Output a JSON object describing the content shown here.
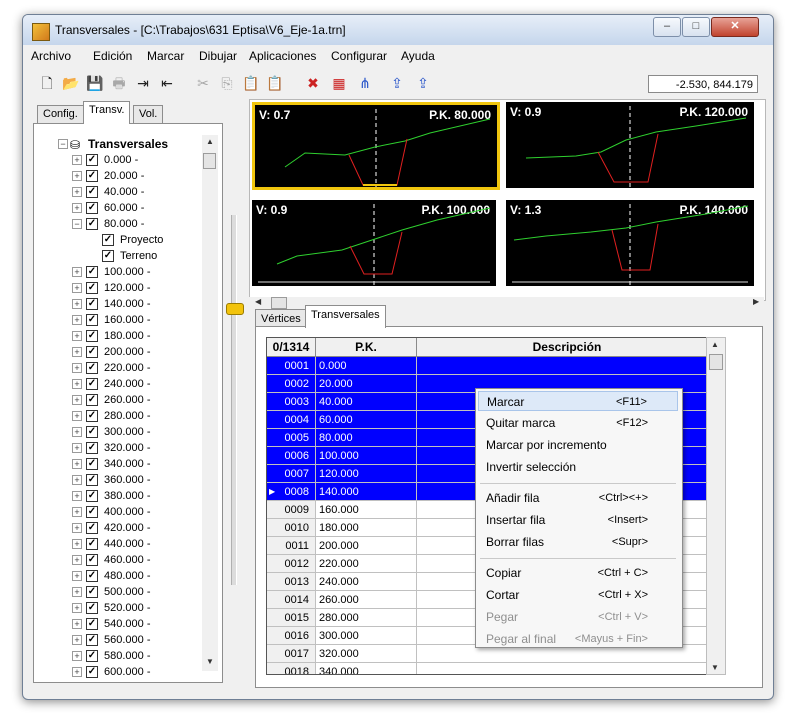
{
  "window": {
    "title": "Transversales - [C:\\Trabajos\\631 Eptisa\\V6_Eje-1a.trn]"
  },
  "menu": [
    "Archivo",
    "Edición",
    "Marcar",
    "Dibujar",
    "Aplicaciones",
    "Configurar",
    "Ayuda"
  ],
  "toolbar": {
    "icons": [
      "new-icon",
      "open-icon",
      "save-icon",
      "print-icon",
      "export-icon",
      "import-icon",
      "cut-icon",
      "copy-icon",
      "paste-icon",
      "paste-end-icon",
      "mark-tool-icon",
      "report-icon",
      "sections-icon",
      "send-icon",
      "send-all-icon"
    ],
    "coords": "-2.530, 844.179"
  },
  "left_tabs": [
    "Config.",
    "Transv.",
    "Vol."
  ],
  "tree": {
    "root": "Transversales",
    "items": [
      "0.000 -",
      "20.000 -",
      "40.000 -",
      "60.000 -",
      "80.000 -",
      "100.000 -",
      "120.000 -",
      "140.000 -",
      "160.000 -",
      "180.000 -",
      "200.000 -",
      "220.000 -",
      "240.000 -",
      "260.000 -",
      "280.000 -",
      "300.000 -",
      "320.000 -",
      "340.000 -",
      "360.000 -",
      "380.000 -",
      "400.000 -",
      "420.000 -",
      "440.000 -",
      "460.000 -",
      "480.000 -",
      "500.000 -",
      "520.000 -",
      "540.000 -",
      "560.000 -",
      "580.000 -",
      "600.000 -"
    ],
    "expanded_children": [
      "Proyecto",
      "Terreno"
    ]
  },
  "sections": [
    {
      "v": "V: 0.7",
      "pk": "P.K. 80.000"
    },
    {
      "v": "V: 0.9",
      "pk": "P.K. 120.000"
    },
    {
      "v": "V: 0.9",
      "pk": "P.K. 100.000"
    },
    {
      "v": "V: 1.3",
      "pk": "P.K. 140.000"
    }
  ],
  "bottom_tabs": [
    "Vértices",
    "Transversales"
  ],
  "grid": {
    "headers": [
      "0/1314",
      "P.K.",
      "Descripción"
    ],
    "rows": [
      {
        "id": "0001",
        "pk": "0.000",
        "selected": true
      },
      {
        "id": "0002",
        "pk": "20.000",
        "selected": true
      },
      {
        "id": "0003",
        "pk": "40.000",
        "selected": true
      },
      {
        "id": "0004",
        "pk": "60.000",
        "selected": true
      },
      {
        "id": "0005",
        "pk": "80.000",
        "selected": true
      },
      {
        "id": "0006",
        "pk": "100.000",
        "selected": true
      },
      {
        "id": "0007",
        "pk": "120.000",
        "selected": true
      },
      {
        "id": "0008",
        "pk": "140.000",
        "selected": true,
        "current": true
      },
      {
        "id": "0009",
        "pk": "160.000",
        "selected": false
      },
      {
        "id": "0010",
        "pk": "180.000",
        "selected": false
      },
      {
        "id": "0011",
        "pk": "200.000",
        "selected": false
      },
      {
        "id": "0012",
        "pk": "220.000",
        "selected": false
      },
      {
        "id": "0013",
        "pk": "240.000",
        "selected": false
      },
      {
        "id": "0014",
        "pk": "260.000",
        "selected": false
      },
      {
        "id": "0015",
        "pk": "280.000",
        "selected": false
      },
      {
        "id": "0016",
        "pk": "300.000",
        "selected": false
      },
      {
        "id": "0017",
        "pk": "320.000",
        "selected": false
      },
      {
        "id": "0018",
        "pk": "340.000",
        "selected": false
      }
    ]
  },
  "context_menu": [
    {
      "label": "Marcar",
      "key": "<F11>",
      "highlight": true
    },
    {
      "label": "Quitar marca",
      "key": "<F12>"
    },
    {
      "label": "Marcar por incremento",
      "key": ""
    },
    {
      "label": "Invertir selección",
      "key": ""
    },
    {
      "sep": true
    },
    {
      "label": "Añadir fila",
      "key": "<Ctrl><+>"
    },
    {
      "label": "Insertar fila",
      "key": "<Insert>"
    },
    {
      "label": "Borrar filas",
      "key": "<Supr>"
    },
    {
      "sep": true
    },
    {
      "label": "Copiar",
      "key": "<Ctrl + C>"
    },
    {
      "label": "Cortar",
      "key": "<Ctrl + X>"
    },
    {
      "label": "Pegar",
      "key": "<Ctrl + V>",
      "disabled": true
    },
    {
      "label": "Pegar al final",
      "key": "<Mayus + Fin>",
      "disabled": true
    }
  ],
  "colors": {
    "selection": "#0000ff",
    "section_bg": "#000000",
    "terrain_line": "#2fd02f",
    "project_line": "#e02020",
    "selected_border": "#f1c60e"
  }
}
